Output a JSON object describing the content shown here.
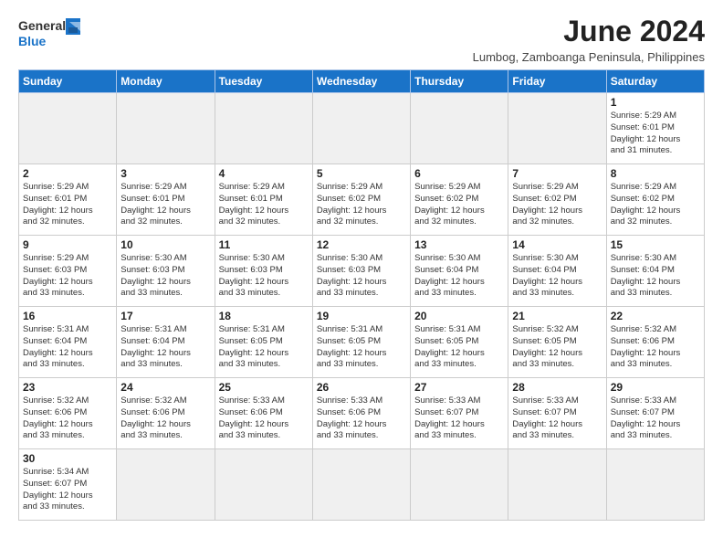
{
  "logo": {
    "line1": "General",
    "line2": "Blue"
  },
  "title": "June 2024",
  "location": "Lumbog, Zamboanga Peninsula, Philippines",
  "weekdays": [
    "Sunday",
    "Monday",
    "Tuesday",
    "Wednesday",
    "Thursday",
    "Friday",
    "Saturday"
  ],
  "weeks": [
    [
      {
        "day": "",
        "info": "",
        "empty": true
      },
      {
        "day": "",
        "info": "",
        "empty": true
      },
      {
        "day": "",
        "info": "",
        "empty": true
      },
      {
        "day": "",
        "info": "",
        "empty": true
      },
      {
        "day": "",
        "info": "",
        "empty": true
      },
      {
        "day": "",
        "info": "",
        "empty": true
      },
      {
        "day": "1",
        "info": "Sunrise: 5:29 AM\nSunset: 6:01 PM\nDaylight: 12 hours\nand 31 minutes."
      }
    ],
    [
      {
        "day": "2",
        "info": "Sunrise: 5:29 AM\nSunset: 6:01 PM\nDaylight: 12 hours\nand 32 minutes."
      },
      {
        "day": "3",
        "info": "Sunrise: 5:29 AM\nSunset: 6:01 PM\nDaylight: 12 hours\nand 32 minutes."
      },
      {
        "day": "4",
        "info": "Sunrise: 5:29 AM\nSunset: 6:01 PM\nDaylight: 12 hours\nand 32 minutes."
      },
      {
        "day": "5",
        "info": "Sunrise: 5:29 AM\nSunset: 6:02 PM\nDaylight: 12 hours\nand 32 minutes."
      },
      {
        "day": "6",
        "info": "Sunrise: 5:29 AM\nSunset: 6:02 PM\nDaylight: 12 hours\nand 32 minutes."
      },
      {
        "day": "7",
        "info": "Sunrise: 5:29 AM\nSunset: 6:02 PM\nDaylight: 12 hours\nand 32 minutes."
      },
      {
        "day": "8",
        "info": "Sunrise: 5:29 AM\nSunset: 6:02 PM\nDaylight: 12 hours\nand 32 minutes."
      }
    ],
    [
      {
        "day": "9",
        "info": "Sunrise: 5:29 AM\nSunset: 6:03 PM\nDaylight: 12 hours\nand 33 minutes."
      },
      {
        "day": "10",
        "info": "Sunrise: 5:30 AM\nSunset: 6:03 PM\nDaylight: 12 hours\nand 33 minutes."
      },
      {
        "day": "11",
        "info": "Sunrise: 5:30 AM\nSunset: 6:03 PM\nDaylight: 12 hours\nand 33 minutes."
      },
      {
        "day": "12",
        "info": "Sunrise: 5:30 AM\nSunset: 6:03 PM\nDaylight: 12 hours\nand 33 minutes."
      },
      {
        "day": "13",
        "info": "Sunrise: 5:30 AM\nSunset: 6:04 PM\nDaylight: 12 hours\nand 33 minutes."
      },
      {
        "day": "14",
        "info": "Sunrise: 5:30 AM\nSunset: 6:04 PM\nDaylight: 12 hours\nand 33 minutes."
      },
      {
        "day": "15",
        "info": "Sunrise: 5:30 AM\nSunset: 6:04 PM\nDaylight: 12 hours\nand 33 minutes."
      }
    ],
    [
      {
        "day": "16",
        "info": "Sunrise: 5:31 AM\nSunset: 6:04 PM\nDaylight: 12 hours\nand 33 minutes."
      },
      {
        "day": "17",
        "info": "Sunrise: 5:31 AM\nSunset: 6:04 PM\nDaylight: 12 hours\nand 33 minutes."
      },
      {
        "day": "18",
        "info": "Sunrise: 5:31 AM\nSunset: 6:05 PM\nDaylight: 12 hours\nand 33 minutes."
      },
      {
        "day": "19",
        "info": "Sunrise: 5:31 AM\nSunset: 6:05 PM\nDaylight: 12 hours\nand 33 minutes."
      },
      {
        "day": "20",
        "info": "Sunrise: 5:31 AM\nSunset: 6:05 PM\nDaylight: 12 hours\nand 33 minutes."
      },
      {
        "day": "21",
        "info": "Sunrise: 5:32 AM\nSunset: 6:05 PM\nDaylight: 12 hours\nand 33 minutes."
      },
      {
        "day": "22",
        "info": "Sunrise: 5:32 AM\nSunset: 6:06 PM\nDaylight: 12 hours\nand 33 minutes."
      }
    ],
    [
      {
        "day": "23",
        "info": "Sunrise: 5:32 AM\nSunset: 6:06 PM\nDaylight: 12 hours\nand 33 minutes."
      },
      {
        "day": "24",
        "info": "Sunrise: 5:32 AM\nSunset: 6:06 PM\nDaylight: 12 hours\nand 33 minutes."
      },
      {
        "day": "25",
        "info": "Sunrise: 5:33 AM\nSunset: 6:06 PM\nDaylight: 12 hours\nand 33 minutes."
      },
      {
        "day": "26",
        "info": "Sunrise: 5:33 AM\nSunset: 6:06 PM\nDaylight: 12 hours\nand 33 minutes."
      },
      {
        "day": "27",
        "info": "Sunrise: 5:33 AM\nSunset: 6:07 PM\nDaylight: 12 hours\nand 33 minutes."
      },
      {
        "day": "28",
        "info": "Sunrise: 5:33 AM\nSunset: 6:07 PM\nDaylight: 12 hours\nand 33 minutes."
      },
      {
        "day": "29",
        "info": "Sunrise: 5:33 AM\nSunset: 6:07 PM\nDaylight: 12 hours\nand 33 minutes."
      }
    ],
    [
      {
        "day": "30",
        "info": "Sunrise: 5:34 AM\nSunset: 6:07 PM\nDaylight: 12 hours\nand 33 minutes."
      },
      {
        "day": "",
        "info": "",
        "empty": true
      },
      {
        "day": "",
        "info": "",
        "empty": true
      },
      {
        "day": "",
        "info": "",
        "empty": true
      },
      {
        "day": "",
        "info": "",
        "empty": true
      },
      {
        "day": "",
        "info": "",
        "empty": true
      },
      {
        "day": "",
        "info": "",
        "empty": true
      }
    ]
  ]
}
